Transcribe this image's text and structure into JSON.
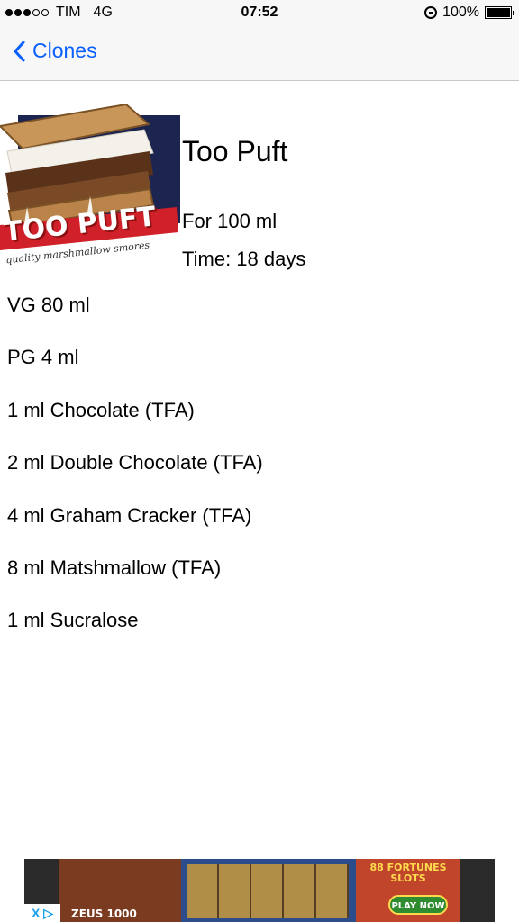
{
  "status_bar": {
    "carrier": "TIM",
    "network": "4G",
    "time": "07:52",
    "battery": "100%",
    "signal_bars": 3
  },
  "nav": {
    "back_label": "Clones",
    "back_icon": "chevron-left-icon",
    "accent_color": "#0a60ff"
  },
  "recipe": {
    "title": "Too Puft",
    "logo_text": "TOO PUFT",
    "logo_tagline": "quality marshmallow smores",
    "amount": "For 100 ml",
    "time": "Time: 18 days",
    "ingredients": [
      "VG 80 ml",
      "PG 4 ml",
      "1 ml Chocolate (TFA)",
      "2 ml Double Chocolate (TFA)",
      "4 ml Graham Cracker (TFA)",
      "8 ml Matshmallow (TFA)",
      "1 ml Sucralose"
    ]
  },
  "ad": {
    "left_text": "ZEUS 1000",
    "right_title": "88 FORTUNES SLOTS",
    "button_label": "PLAY NOW",
    "adchoices": "X ▷"
  }
}
